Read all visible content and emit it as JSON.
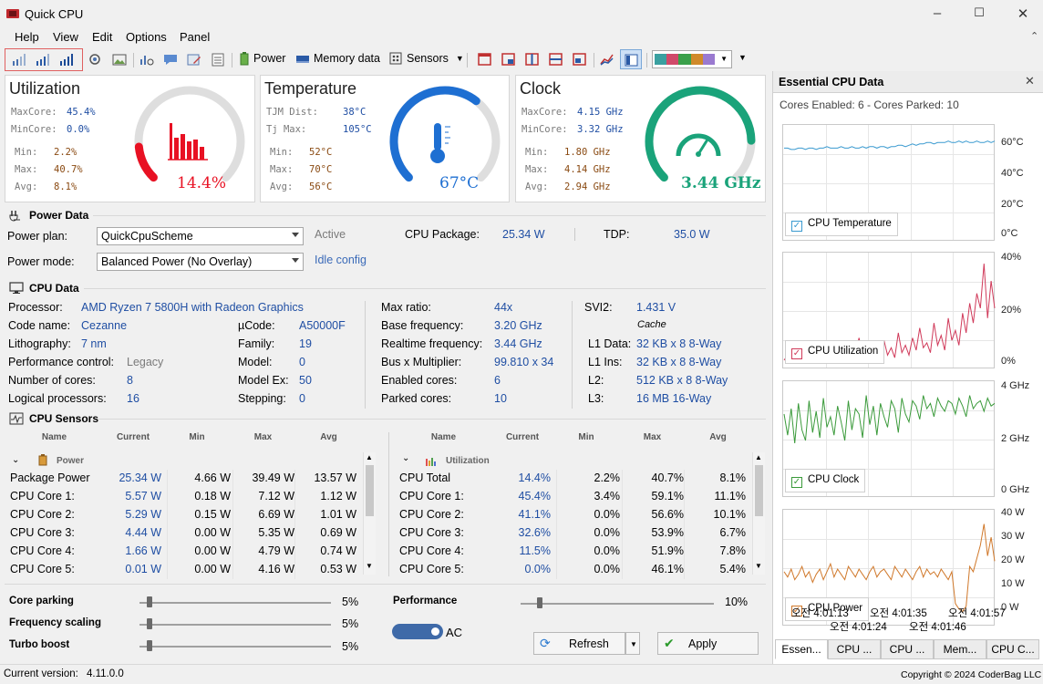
{
  "app": {
    "title": "Quick CPU"
  },
  "menu": [
    "Help",
    "View",
    "Edit",
    "Options",
    "Panel"
  ],
  "toolbar": {
    "power_label": "Power",
    "memory_label": "Memory data",
    "sensors_label": "Sensors"
  },
  "utilization": {
    "title": "Utilization",
    "rows": [
      [
        "MaxCore:",
        "45.4%"
      ],
      [
        "MinCore:",
        "0.0%"
      ]
    ],
    "stats": [
      [
        "Min:",
        "2.2%"
      ],
      [
        "Max:",
        "40.7%"
      ],
      [
        "Avg:",
        "8.1%"
      ]
    ],
    "value": "14.4%",
    "level": 0.144,
    "color": "#e81123"
  },
  "temperature": {
    "title": "Temperature",
    "rows": [
      [
        "TJM Dist:",
        "38°C"
      ],
      [
        "Tj Max:",
        "105°C"
      ]
    ],
    "stats": [
      [
        "Min:",
        "52°C"
      ],
      [
        "Max:",
        "70°C"
      ],
      [
        "Avg:",
        "56°C"
      ]
    ],
    "value": "67°C",
    "level": 0.64,
    "color": "#1e6fd2"
  },
  "clock": {
    "title": "Clock",
    "rows": [
      [
        "MaxCore:",
        "4.15 GHz"
      ],
      [
        "MinCore:",
        "3.32 GHz"
      ]
    ],
    "stats": [
      [
        "Min:",
        "1.80 GHz"
      ],
      [
        "Max:",
        "4.14 GHz"
      ],
      [
        "Avg:",
        "2.94 GHz"
      ]
    ],
    "value": "3.44 GHz",
    "level": 0.83,
    "color": "#1aa37a"
  },
  "power_data": {
    "title": "Power Data",
    "plan_label": "Power plan:",
    "plan_value": "QuickCpuScheme",
    "plan_status": "Active",
    "mode_label": "Power mode:",
    "mode_value": "Balanced Power (No Overlay)",
    "idle_link": "Idle config",
    "package_label": "CPU Package:",
    "package_value": "25.34 W",
    "tdp_label": "TDP:",
    "tdp_value": "35.0 W"
  },
  "cpu_data": {
    "title": "CPU Data",
    "col1": [
      [
        "Processor:",
        "AMD Ryzen 7 5800H with Radeon Graphics"
      ],
      [
        "Code name:",
        "Cezanne"
      ],
      [
        "Lithography:",
        "7 nm"
      ],
      [
        "Performance control:",
        "Legacy"
      ],
      [
        "Number of cores:",
        "8"
      ],
      [
        "Logical processors:",
        "16"
      ]
    ],
    "col2": [
      [
        "µCode:",
        "A50000F"
      ],
      [
        "Family:",
        "19"
      ],
      [
        "Model:",
        "0"
      ],
      [
        "Model Ex:",
        "50"
      ],
      [
        "Stepping:",
        "0"
      ]
    ],
    "col3": [
      [
        "Max ratio:",
        "44x"
      ],
      [
        "Base frequency:",
        "3.20 GHz"
      ],
      [
        "Realtime frequency:",
        "3.44 GHz"
      ],
      [
        "Bus x Multiplier:",
        "99.810 x 34"
      ],
      [
        "Enabled cores:",
        "6"
      ],
      [
        "Parked cores:",
        "10"
      ]
    ],
    "svi2_label": "SVI2:",
    "svi2_value": "1.431 V",
    "cache_label": "Cache",
    "cache": [
      [
        "L1 Data:",
        "32 KB x 8  8-Way"
      ],
      [
        "L1 Ins:",
        "32 KB x 8  8-Way"
      ],
      [
        "L2:",
        "512 KB x 8  8-Way"
      ],
      [
        "L3:",
        "16 MB  16-Way"
      ]
    ]
  },
  "sensors": {
    "title": "CPU Sensors",
    "headers": [
      "Name",
      "Current",
      "Min",
      "Max",
      "Avg"
    ],
    "left_group": "Power",
    "left_rows": [
      [
        "Package Power",
        "25.34 W",
        "4.66 W",
        "39.49 W",
        "13.57 W"
      ],
      [
        "CPU Core 1:",
        "5.57 W",
        "0.18 W",
        "7.12 W",
        "1.12 W"
      ],
      [
        "CPU Core 2:",
        "5.29 W",
        "0.15 W",
        "6.69 W",
        "1.01 W"
      ],
      [
        "CPU Core 3:",
        "4.44 W",
        "0.00 W",
        "5.35 W",
        "0.69 W"
      ],
      [
        "CPU Core 4:",
        "1.66 W",
        "0.00 W",
        "4.79 W",
        "0.74 W"
      ],
      [
        "CPU Core 5:",
        "0.01 W",
        "0.00 W",
        "4.16 W",
        "0.53 W"
      ]
    ],
    "right_group": "Utilization",
    "right_rows": [
      [
        "CPU Total",
        "14.4%",
        "2.2%",
        "40.7%",
        "8.1%"
      ],
      [
        "CPU Core 1:",
        "45.4%",
        "3.4%",
        "59.1%",
        "11.1%"
      ],
      [
        "CPU Core 2:",
        "41.1%",
        "0.0%",
        "56.6%",
        "10.1%"
      ],
      [
        "CPU Core 3:",
        "32.6%",
        "0.0%",
        "53.9%",
        "6.7%"
      ],
      [
        "CPU Core 4:",
        "11.5%",
        "0.0%",
        "51.9%",
        "7.8%"
      ],
      [
        "CPU Core 5:",
        "0.0%",
        "0.0%",
        "46.1%",
        "5.4%"
      ]
    ]
  },
  "controls": {
    "core_parking": {
      "label": "Core parking",
      "value": "5%",
      "level": 0.05
    },
    "freq_scaling": {
      "label": "Frequency scaling",
      "value": "5%",
      "level": 0.05
    },
    "turbo_boost": {
      "label": "Turbo boost",
      "value": "5%",
      "level": 0.05
    },
    "performance": {
      "label": "Performance",
      "value": "10%",
      "level": 0.1
    },
    "ac_label": "AC",
    "refresh_label": "Refresh",
    "apply_label": "Apply"
  },
  "essential": {
    "title": "Essential CPU Data",
    "summary": "Cores Enabled: 6 - Cores Parked: 10",
    "graphs": [
      {
        "label": "CPU Temperature",
        "ticks": [
          "60°C",
          "40°C",
          "20°C",
          "0°C"
        ],
        "color": "#3a9ad0",
        "min": 0,
        "max": 80,
        "values": [
          66,
          66,
          65,
          65,
          66,
          66,
          65,
          66,
          66,
          65,
          66,
          66,
          67,
          66,
          66,
          66,
          67,
          66,
          66,
          67,
          66,
          66,
          67,
          66,
          67,
          67,
          66,
          67,
          67,
          66,
          67,
          67,
          68,
          68,
          67,
          68,
          69,
          68,
          69,
          69,
          70,
          70,
          69,
          70,
          70,
          70,
          71,
          70,
          70,
          71,
          70,
          71,
          70,
          70,
          71,
          70,
          70,
          71,
          70,
          71
        ]
      },
      {
        "label": "CPU Utilization",
        "ticks": [
          "40%",
          "20%",
          "0%"
        ],
        "color": "#d03a5a",
        "min": 0,
        "max": 45,
        "values": [
          3,
          5,
          2,
          6,
          3,
          8,
          4,
          2,
          7,
          5,
          3,
          9,
          4,
          6,
          3,
          10,
          5,
          4,
          8,
          3,
          6,
          12,
          5,
          7,
          4,
          9,
          6,
          3,
          11,
          5,
          8,
          4,
          14,
          6,
          9,
          5,
          12,
          7,
          16,
          8,
          10,
          6,
          18,
          9,
          13,
          7,
          20,
          11,
          15,
          9,
          22,
          14,
          26,
          18,
          30,
          24,
          42,
          20,
          35,
          24
        ]
      },
      {
        "label": "CPU Clock",
        "ticks": [
          "4 GHz",
          "2 GHz",
          "0 GHz"
        ],
        "color": "#3a9a3a",
        "min": 0,
        "max": 4.2,
        "values": [
          3.1,
          2.3,
          3.3,
          2.0,
          3.5,
          2.5,
          2.1,
          3.6,
          2.4,
          3.2,
          2.2,
          3.7,
          2.6,
          3.0,
          2.3,
          3.4,
          2.8,
          2.1,
          3.6,
          2.5,
          3.3,
          3.1,
          2.2,
          3.8,
          2.7,
          3.4,
          2.3,
          3.5,
          3.0,
          2.6,
          3.6,
          3.3,
          2.4,
          3.7,
          3.1,
          2.8,
          3.6,
          3.4,
          2.9,
          3.8,
          3.3,
          3.5,
          3.0,
          3.7,
          3.4,
          3.2,
          3.6,
          3.5,
          3.1,
          3.7,
          3.4,
          3.0,
          3.8,
          3.3,
          3.5,
          3.6,
          3.2,
          3.7,
          3.4,
          3.5
        ]
      },
      {
        "label": "CPU Power",
        "ticks": [
          "40 W",
          "30 W",
          "20 W",
          "10 W",
          "0 W"
        ],
        "color": "#d0782a",
        "min": 0,
        "max": 42,
        "values": [
          20,
          18,
          21,
          17,
          19,
          22,
          18,
          20,
          16,
          19,
          21,
          17,
          20,
          23,
          18,
          21,
          19,
          17,
          22,
          20,
          18,
          21,
          19,
          17,
          20,
          22,
          18,
          20,
          21,
          19,
          17,
          22,
          20,
          18,
          21,
          19,
          17,
          20,
          22,
          18,
          21,
          19,
          20,
          18,
          21,
          19,
          17,
          20,
          8,
          6,
          5,
          7,
          22,
          20,
          25,
          30,
          38,
          26,
          33,
          24
        ]
      }
    ],
    "x_labels_top": [
      "오전 4:01:13",
      "오전 4:01:35",
      "오전 4:01:57"
    ],
    "x_labels_bottom": [
      "오전 4:01:24",
      "오전 4:01:46"
    ],
    "tabs": [
      "Essen...",
      "CPU ...",
      "CPU ...",
      "Mem...",
      "CPU C..."
    ]
  },
  "status": {
    "version_label": "Current version:",
    "version_value": "4.11.0.0",
    "copyright": "Copyright © 2024 CoderBag LLC"
  }
}
